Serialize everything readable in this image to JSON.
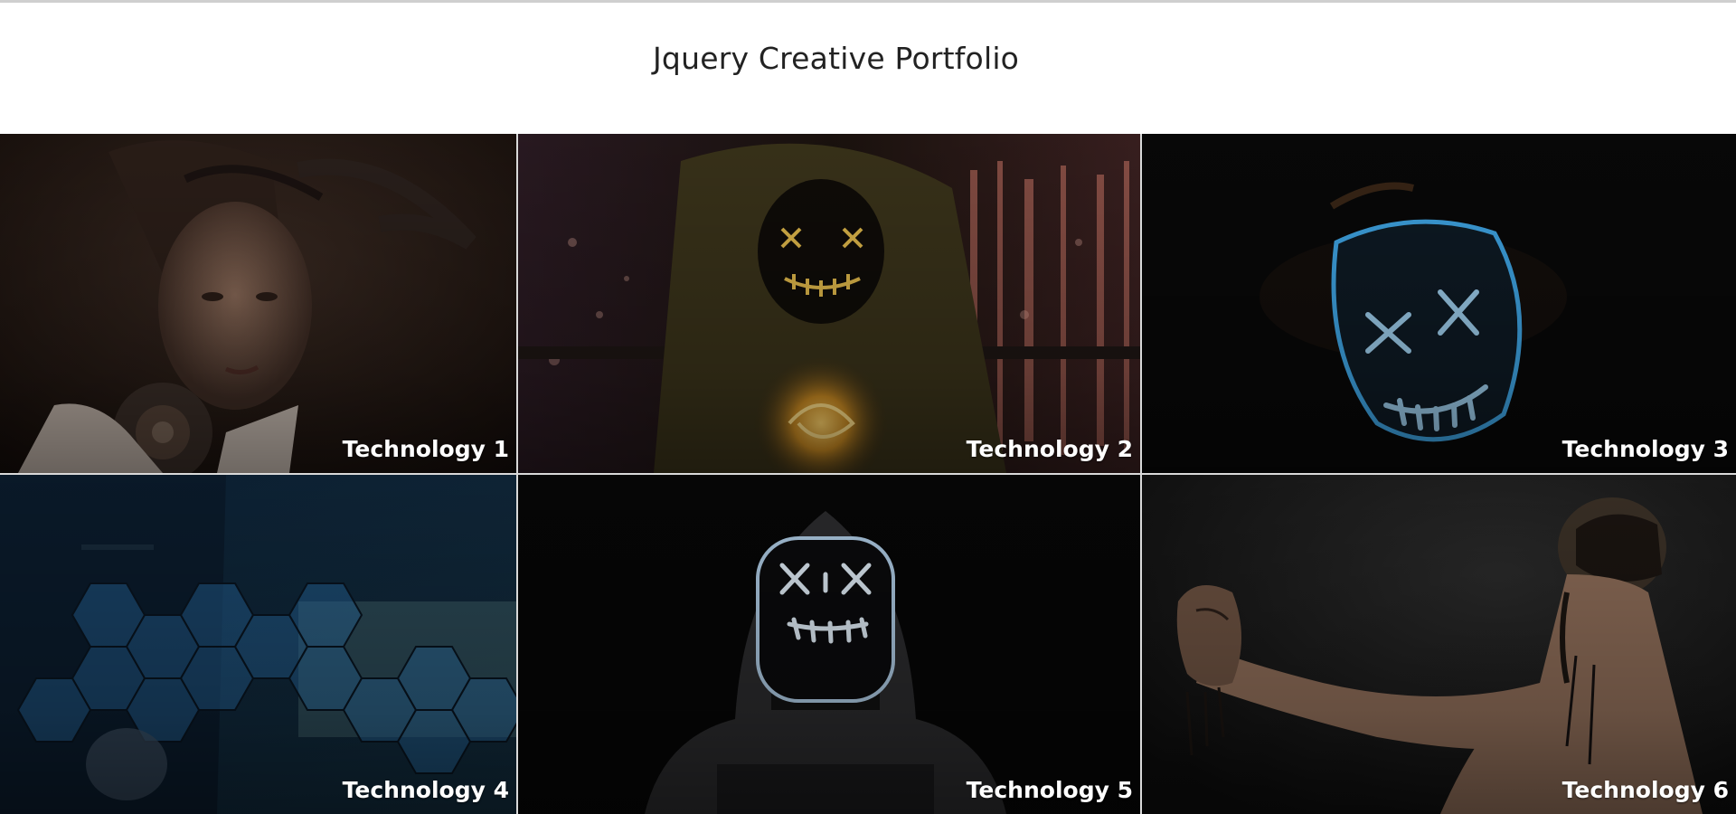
{
  "header": {
    "title": "Jquery Creative Portfolio"
  },
  "tiles": [
    {
      "label": "Technology 1",
      "subject": "cyborg-woman-image"
    },
    {
      "label": "Technology 2",
      "subject": "hooded-figure-neon-mask-city-image"
    },
    {
      "label": "Technology 3",
      "subject": "blue-neon-mask-image"
    },
    {
      "label": "Technology 4",
      "subject": "business-hexagon-city-image"
    },
    {
      "label": "Technology 5",
      "subject": "hooded-figure-led-mask-image"
    },
    {
      "label": "Technology 6",
      "subject": "man-holding-face-mask-image"
    }
  ],
  "colors": {
    "caption": "#ffffff",
    "title": "#222222",
    "divider": "#d9d9d9"
  }
}
